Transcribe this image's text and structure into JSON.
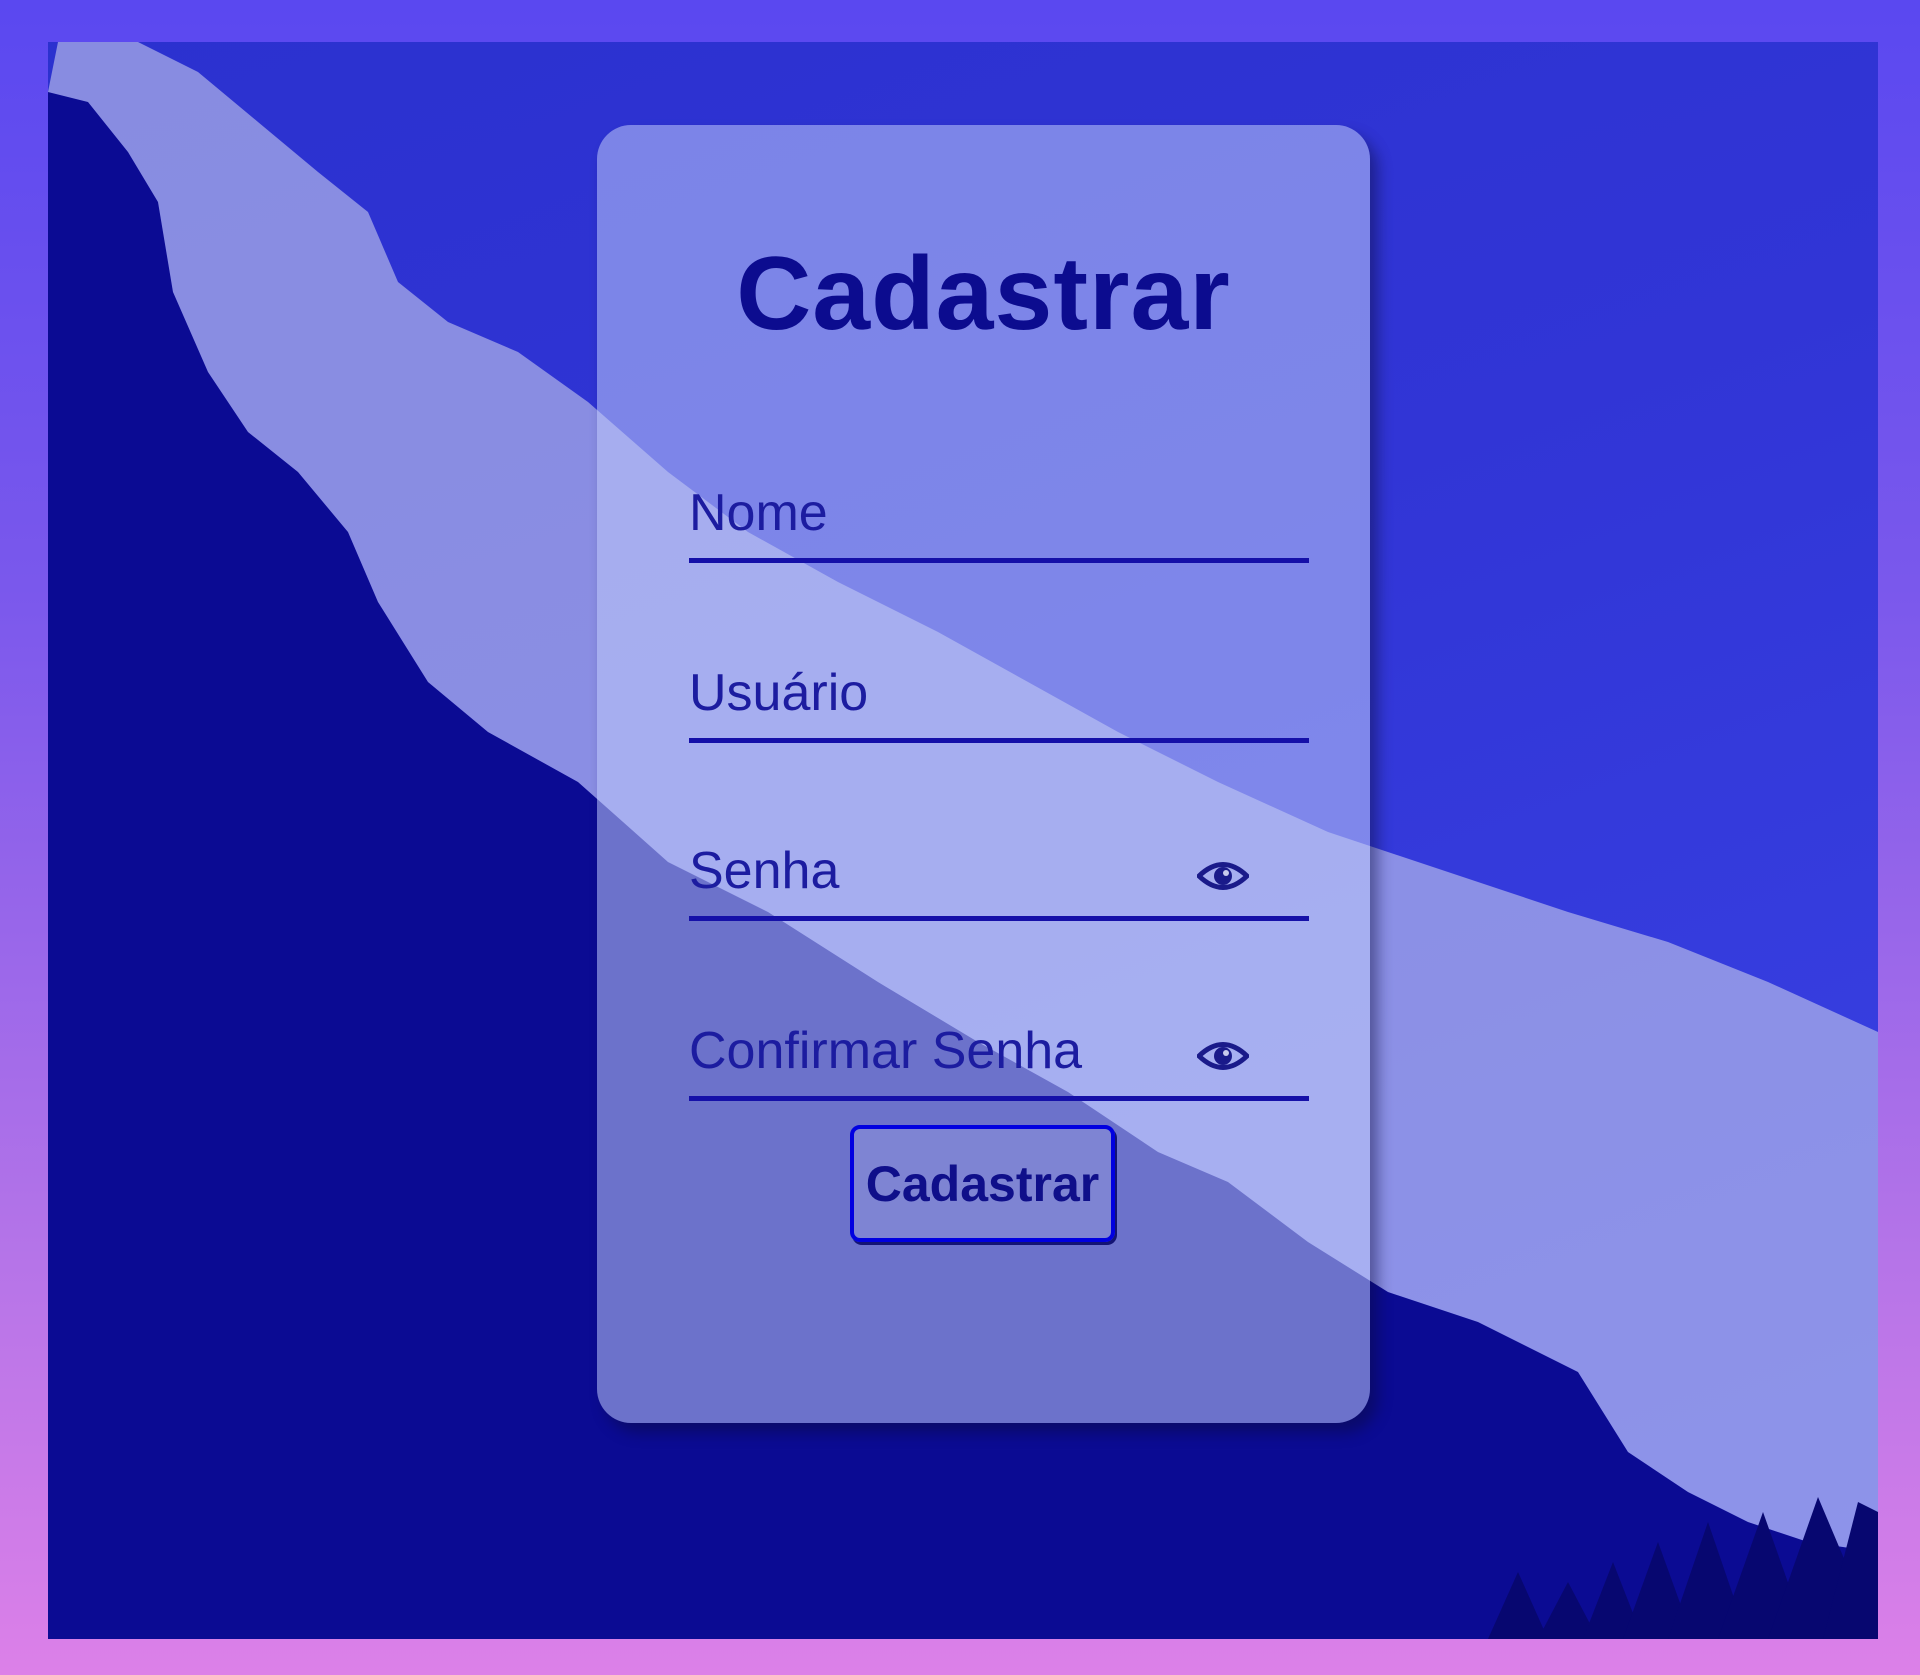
{
  "form": {
    "title": "Cadastrar",
    "fields": [
      {
        "placeholder": "Nome",
        "value": "",
        "type": "text"
      },
      {
        "placeholder": "Usuário",
        "value": "",
        "type": "text"
      },
      {
        "placeholder": "Senha",
        "value": "",
        "type": "password",
        "icon": "eye-icon"
      },
      {
        "placeholder": "Confirmar Senha",
        "value": "",
        "type": "password",
        "icon": "eye-icon"
      }
    ],
    "submit_label": "Cadastrar"
  },
  "colors": {
    "page_gradient_top": "#5a48f0",
    "page_gradient_bottom": "#dc80e8",
    "sky": "#3135d6",
    "mountain": "#0b0b93",
    "accent_text": "#0c0c8f",
    "underline": "#1510a8",
    "button_border": "#0000e0"
  }
}
